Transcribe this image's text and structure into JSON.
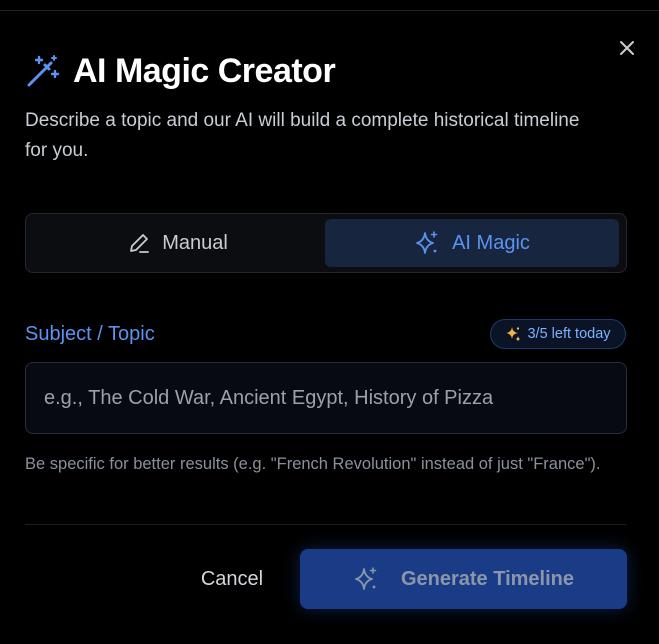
{
  "dialog": {
    "title": "AI Magic Creator",
    "title_icon": "magic-wand-icon",
    "description": "Describe a topic and our AI will build a complete historical timeline for you.",
    "close_icon": "close-icon"
  },
  "mode_toggle": {
    "manual_label": "Manual",
    "manual_icon": "pencil-icon",
    "ai_label": "AI Magic",
    "ai_icon": "sparkles-icon",
    "selected": "AI Magic"
  },
  "topic_field": {
    "label": "Subject / Topic",
    "quota_badge": "3/5 left today",
    "quota_used": 2,
    "quota_total": 5,
    "value": "",
    "placeholder": "e.g., The Cold War, Ancient Egypt, History of Pizza",
    "hint": "Be specific for better results (e.g. \"French Revolution\" instead of just \"France\")."
  },
  "actions": {
    "cancel_label": "Cancel",
    "generate_label": "Generate Timeline",
    "generate_icon": "sparkles-icon"
  },
  "colors": {
    "accent": "#5b93f0",
    "selected_tab_bg": "#18253f",
    "primary_button_bg": "#1a3c86",
    "badge_text": "#7fb0ff",
    "background": "#000000"
  }
}
